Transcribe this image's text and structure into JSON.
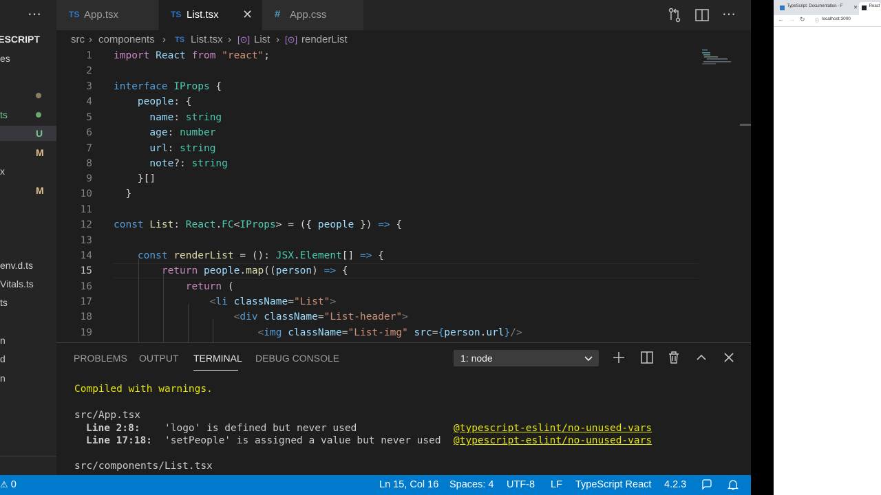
{
  "sidebar": {
    "title": "TYPESCRIPT",
    "rows": [
      {
        "label": "es",
        "badge": "",
        "dot": "",
        "selected": false
      },
      {
        "label": "",
        "badge": "",
        "dot": "#8a7f63",
        "selected": false
      },
      {
        "label": "ts",
        "badge": "",
        "dot": "#6aa66f",
        "selected": false
      },
      {
        "label": "",
        "badge": "U",
        "dot": "",
        "selected": true
      },
      {
        "label": "",
        "badge": "M",
        "dot": "",
        "selected": false
      },
      {
        "label": "x",
        "badge": "",
        "dot": "",
        "selected": false
      },
      {
        "label": "",
        "badge": "M",
        "dot": "",
        "selected": false
      },
      {
        "label": "env.d.ts",
        "badge": "",
        "dot": "",
        "selected": false
      },
      {
        "label": "Vitals.ts",
        "badge": "",
        "dot": "",
        "selected": false
      },
      {
        "label": "ts",
        "badge": "",
        "dot": "",
        "selected": false
      },
      {
        "label": "n",
        "badge": "",
        "dot": "",
        "selected": false
      },
      {
        "label": "d",
        "badge": "",
        "dot": "",
        "selected": false
      },
      {
        "label": "n",
        "badge": "",
        "dot": "",
        "selected": false
      }
    ]
  },
  "tabs": [
    {
      "icon": "TS",
      "label": "App.tsx",
      "active": false
    },
    {
      "icon": "TS",
      "label": "List.tsx",
      "active": true
    },
    {
      "icon": "#",
      "label": "App.css",
      "active": false
    }
  ],
  "breadcrumb": [
    "src",
    "components",
    "List.tsx",
    "List",
    "renderList"
  ],
  "editor": {
    "line_numbers": [
      "1",
      "2",
      "3",
      "4",
      "5",
      "6",
      "7",
      "8",
      "9",
      "10",
      "11",
      "12",
      "13",
      "14",
      "15",
      "16",
      "17",
      "18",
      "19"
    ],
    "current_line": "15",
    "lines": [
      [
        [
          "kc",
          "import"
        ],
        [
          "p",
          " "
        ],
        [
          "v",
          "React"
        ],
        [
          "p",
          " "
        ],
        [
          "kc",
          "from"
        ],
        [
          "p",
          " "
        ],
        [
          "s",
          "\"react\""
        ],
        [
          "p",
          ";"
        ]
      ],
      [],
      [
        [
          "k",
          "interface"
        ],
        [
          "p",
          " "
        ],
        [
          "t",
          "IProps"
        ],
        [
          "p",
          " {"
        ]
      ],
      [
        [
          "p",
          "    "
        ],
        [
          "v",
          "people"
        ],
        [
          "p",
          ": {"
        ]
      ],
      [
        [
          "p",
          "      "
        ],
        [
          "v",
          "name"
        ],
        [
          "p",
          ": "
        ],
        [
          "t",
          "string"
        ]
      ],
      [
        [
          "p",
          "      "
        ],
        [
          "v",
          "age"
        ],
        [
          "p",
          ": "
        ],
        [
          "t",
          "number"
        ]
      ],
      [
        [
          "p",
          "      "
        ],
        [
          "v",
          "url"
        ],
        [
          "p",
          ": "
        ],
        [
          "t",
          "string"
        ]
      ],
      [
        [
          "p",
          "      "
        ],
        [
          "v",
          "note"
        ],
        [
          "p",
          "?: "
        ],
        [
          "t",
          "string"
        ]
      ],
      [
        [
          "p",
          "    }[]"
        ]
      ],
      [
        [
          "p",
          "  }"
        ]
      ],
      [],
      [
        [
          "k",
          "const"
        ],
        [
          "p",
          " "
        ],
        [
          "f",
          "List"
        ],
        [
          "p",
          ": "
        ],
        [
          "t",
          "React"
        ],
        [
          "p",
          "."
        ],
        [
          "t",
          "FC"
        ],
        [
          "p",
          "<"
        ],
        [
          "t",
          "IProps"
        ],
        [
          "p",
          "> = ({ "
        ],
        [
          "v",
          "people"
        ],
        [
          "p",
          " }) "
        ],
        [
          "k",
          "=>"
        ],
        [
          "p",
          " {"
        ]
      ],
      [],
      [
        [
          "p",
          "    "
        ],
        [
          "k",
          "const"
        ],
        [
          "p",
          " "
        ],
        [
          "f",
          "renderList"
        ],
        [
          "p",
          " = (): "
        ],
        [
          "t",
          "JSX"
        ],
        [
          "p",
          "."
        ],
        [
          "t",
          "Element"
        ],
        [
          "p",
          "[] "
        ],
        [
          "k",
          "=>"
        ],
        [
          "p",
          " {"
        ]
      ],
      [
        [
          "p",
          "        "
        ],
        [
          "kc",
          "return"
        ],
        [
          "p",
          " "
        ],
        [
          "v",
          "people"
        ],
        [
          "p",
          "."
        ],
        [
          "f",
          "map"
        ],
        [
          "p",
          "(("
        ],
        [
          "v",
          "person"
        ],
        [
          "p",
          ") "
        ],
        [
          "k",
          "=>"
        ],
        [
          "p",
          " {"
        ]
      ],
      [
        [
          "p",
          "            "
        ],
        [
          "kc",
          "return"
        ],
        [
          "p",
          " ("
        ]
      ],
      [
        [
          "p",
          "                "
        ],
        [
          "br",
          "<"
        ],
        [
          "tg",
          "li"
        ],
        [
          "p",
          " "
        ],
        [
          "v",
          "className"
        ],
        [
          "p",
          "="
        ],
        [
          "s",
          "\"List\""
        ],
        [
          "br",
          ">"
        ]
      ],
      [
        [
          "p",
          "                    "
        ],
        [
          "br",
          "<"
        ],
        [
          "tg",
          "div"
        ],
        [
          "p",
          " "
        ],
        [
          "v",
          "className"
        ],
        [
          "p",
          "="
        ],
        [
          "s",
          "\"List-header\""
        ],
        [
          "br",
          ">"
        ]
      ],
      [
        [
          "p",
          "                        "
        ],
        [
          "br",
          "<"
        ],
        [
          "tg",
          "img"
        ],
        [
          "p",
          " "
        ],
        [
          "v",
          "className"
        ],
        [
          "p",
          "="
        ],
        [
          "s",
          "\"List-img\""
        ],
        [
          "p",
          " "
        ],
        [
          "v",
          "src"
        ],
        [
          "p",
          "="
        ],
        [
          "k",
          "{"
        ],
        [
          "v",
          "person"
        ],
        [
          "p",
          "."
        ],
        [
          "v",
          "url"
        ],
        [
          "k",
          "}"
        ],
        [
          "br",
          "/>"
        ]
      ]
    ]
  },
  "panel": {
    "tabs": [
      "PROBLEMS",
      "OUTPUT",
      "TERMINAL",
      "DEBUG CONSOLE"
    ],
    "active_tab": "TERMINAL",
    "terminal_select": "1: node",
    "terminal": {
      "status": "Compiled with warnings.",
      "file1": "src/App.tsx",
      "warnings": [
        {
          "loc": "Line 2:8:",
          "msg": "'logo' is defined but never used",
          "rule": "@typescript-eslint/no-unused-vars"
        },
        {
          "loc": "Line 17:18:",
          "msg": "'setPeople' is assigned a value but never used",
          "rule": "@typescript-eslint/no-unused-vars"
        }
      ],
      "file2": "src/components/List.tsx"
    }
  },
  "statusbar": {
    "problems": "0",
    "position": "Ln 15, Col 16",
    "spaces": "Spaces: 4",
    "encoding": "UTF-8",
    "eol": "LF",
    "language": "TypeScript React",
    "version": "4.2.3"
  },
  "browser": {
    "tabs": [
      "TypeScript: Documentation - F",
      "React"
    ],
    "url": "localhost:3000"
  },
  "colors": {
    "accent": "#007acc",
    "ts_icon": "#3178c6",
    "css_icon": "#519aba",
    "modified": "#e2c08d",
    "untracked": "#73c991"
  }
}
